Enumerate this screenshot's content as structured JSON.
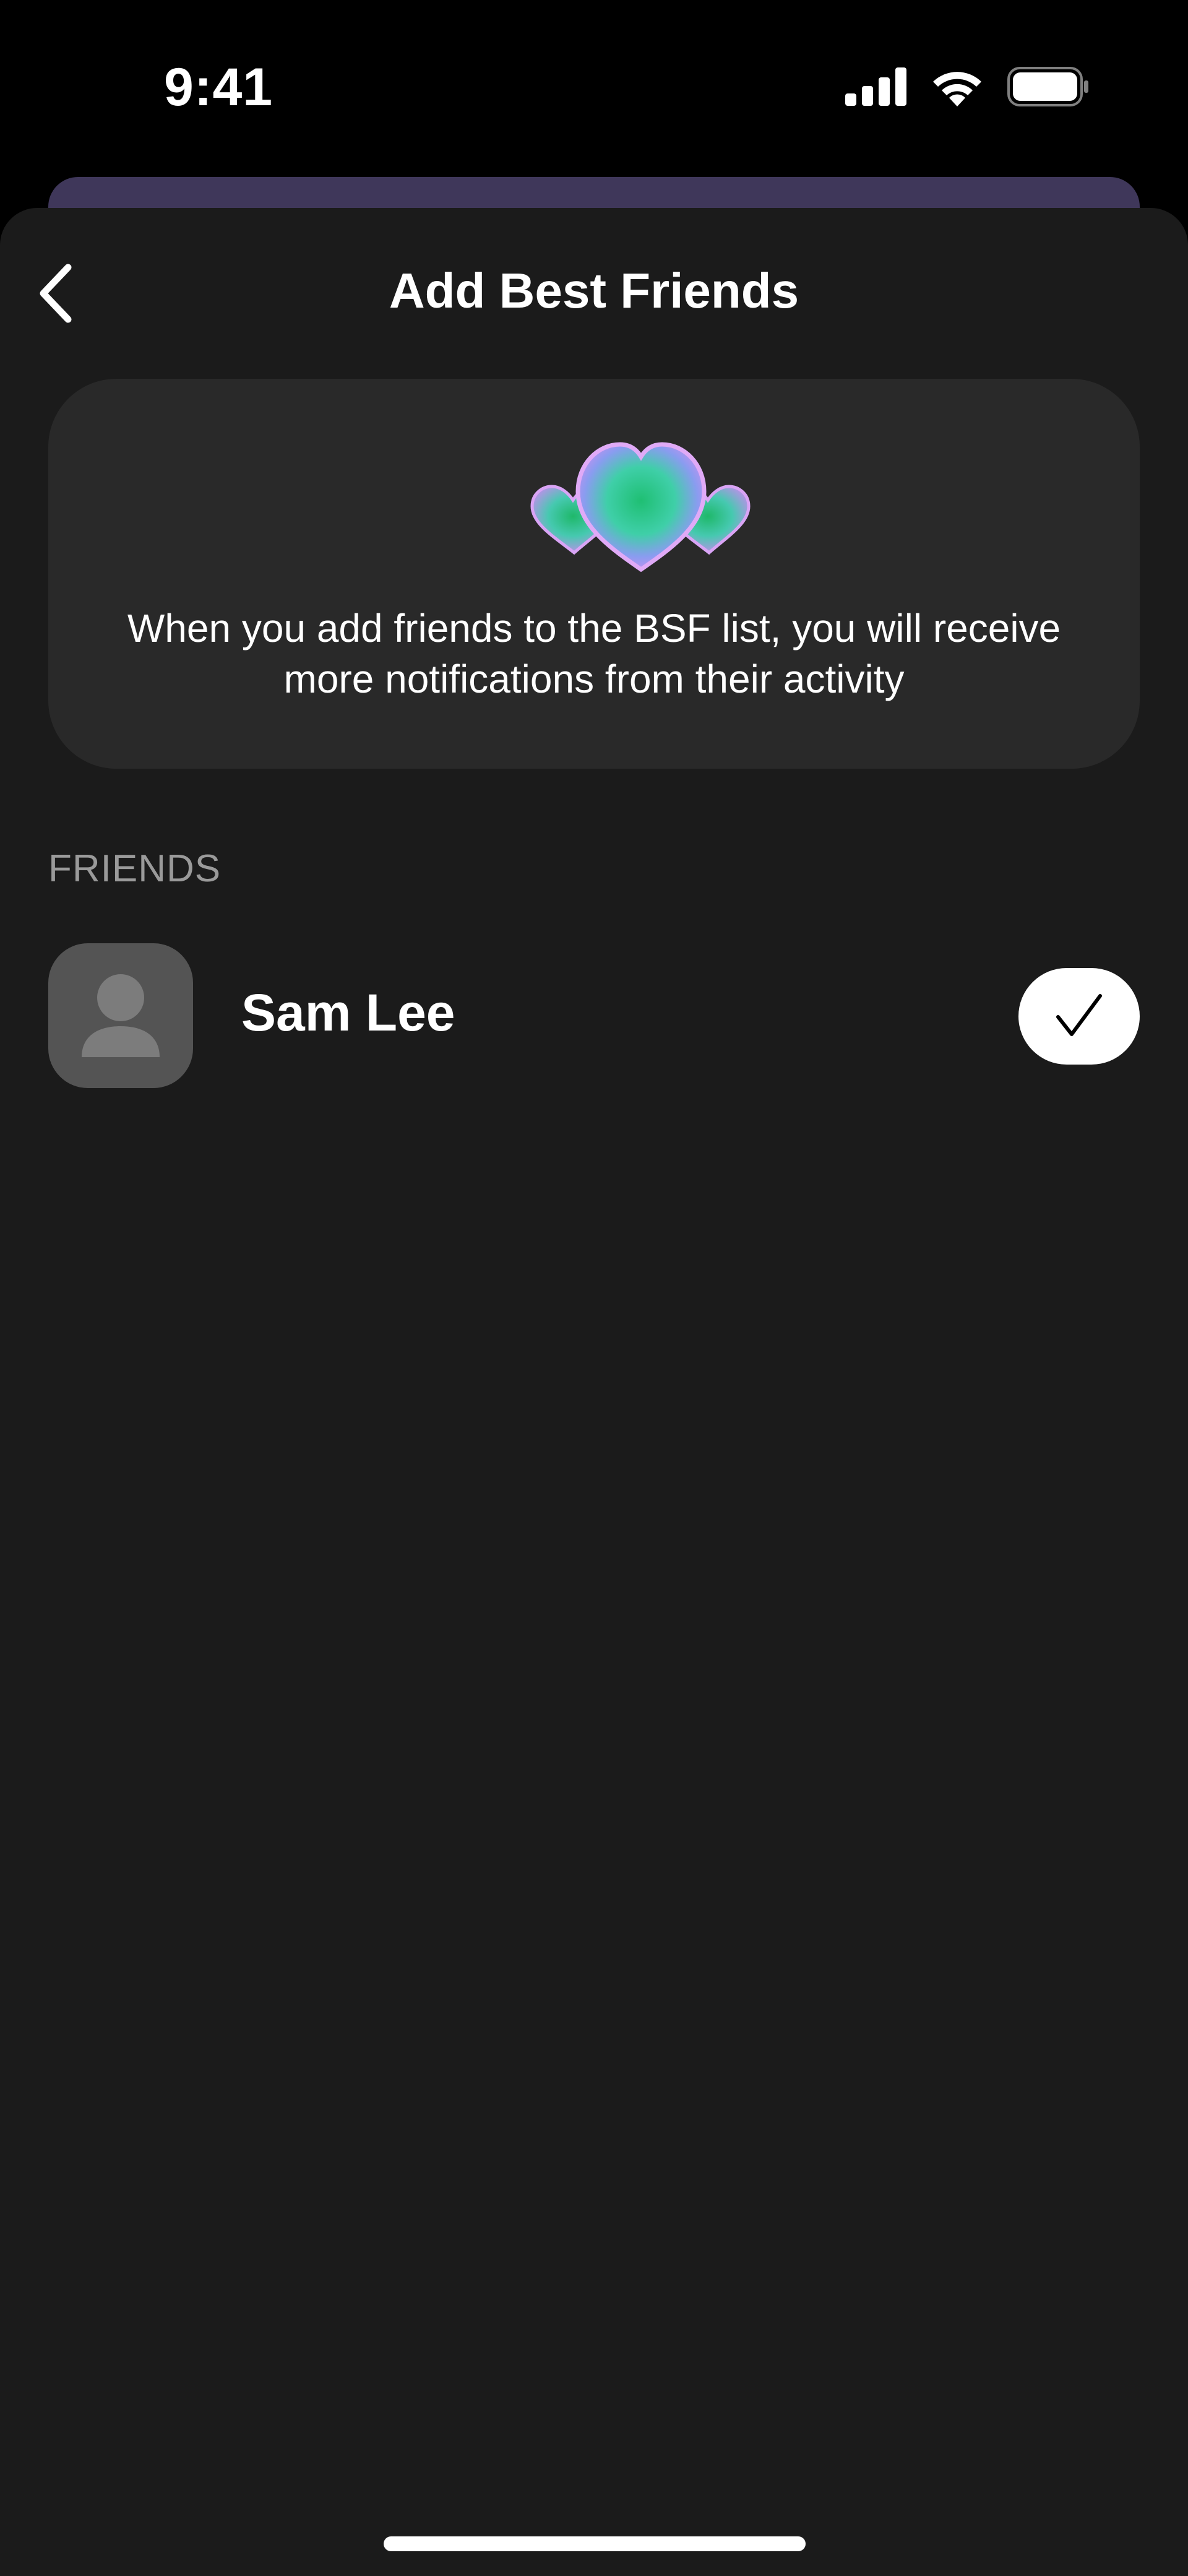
{
  "status_bar": {
    "time": "9:41",
    "icons": [
      "cellular-signal-icon",
      "wifi-icon",
      "battery-icon"
    ]
  },
  "nav": {
    "back_icon": "chevron-left-icon",
    "title": "Add Best Friends"
  },
  "info_card": {
    "illustration": "hearts-icon",
    "text": "When you add friends to the BSF list, you will receive more notifications from their activity"
  },
  "friends_section": {
    "header": "FRIENDS",
    "items": [
      {
        "name": "Sam Lee",
        "avatar_icon": "person-placeholder-icon",
        "selected": true,
        "toggle_icon": "checkmark-icon"
      }
    ]
  },
  "colors": {
    "background": "#000000",
    "sheet": "#1b1b1b",
    "card": "#292929",
    "sheet_behind": "#3f375a",
    "avatar_bg": "#545454",
    "section_header": "#9a9a9a",
    "text": "#ffffff"
  }
}
